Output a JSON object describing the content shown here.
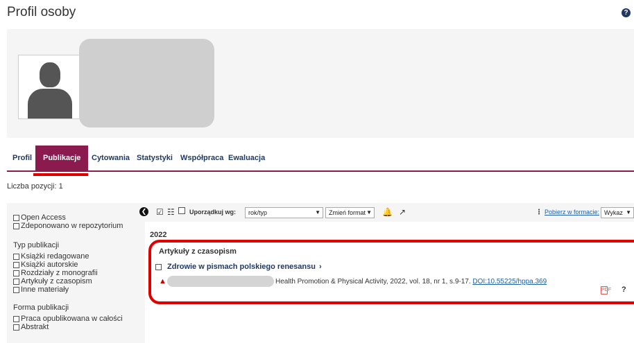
{
  "page": {
    "title": "Profil osoby",
    "help_icon": "?"
  },
  "profile": {
    "avatar_icon": "person-silhouette"
  },
  "tabs": [
    {
      "label": "Profil",
      "active": false
    },
    {
      "label": "Publikacje",
      "active": true
    },
    {
      "label": "Cytowania",
      "active": false
    },
    {
      "label": "Statystyki",
      "active": false
    },
    {
      "label": "Współpraca",
      "active": false
    },
    {
      "label": "Ewaluacja",
      "active": false
    }
  ],
  "count_label": "Liczba pozycji: 1",
  "sidebar": {
    "top_filters": [
      "Open Access",
      "Zdeponowano w repozytorium"
    ],
    "groups": [
      {
        "heading": "Typ publikacji",
        "options": [
          "Książki redagowane",
          "Książki autorskie",
          "Rozdziały z monografii",
          "Artykuły z czasopism",
          "Inne materiały"
        ]
      },
      {
        "heading": "Forma publikacji",
        "options": [
          "Praca opublikowana w całości",
          "Abstrakt"
        ]
      }
    ]
  },
  "toolbar": {
    "sort_label": "Uporządkuj wg:",
    "sort_value": "rok/typ",
    "format_button": "Zmień format",
    "download_label": "Pobierz w formacie:",
    "format_select": "Wykaz"
  },
  "results": {
    "year": "2022",
    "category": "Artykuły z czasopism",
    "items": [
      {
        "title": "Zdrowie w pismach polskiego renesansu",
        "citation": "Health Promotion & Physical Activity, 2022, vol. 18, nr 1, s.9-17. ",
        "doi": "DOI:10.55225/hppa.369",
        "pdf_label": "PDF",
        "info_label": "?"
      }
    ]
  },
  "colors": {
    "accent": "#8b1a4f",
    "link": "#1f3864",
    "highlight": "#e00000"
  }
}
